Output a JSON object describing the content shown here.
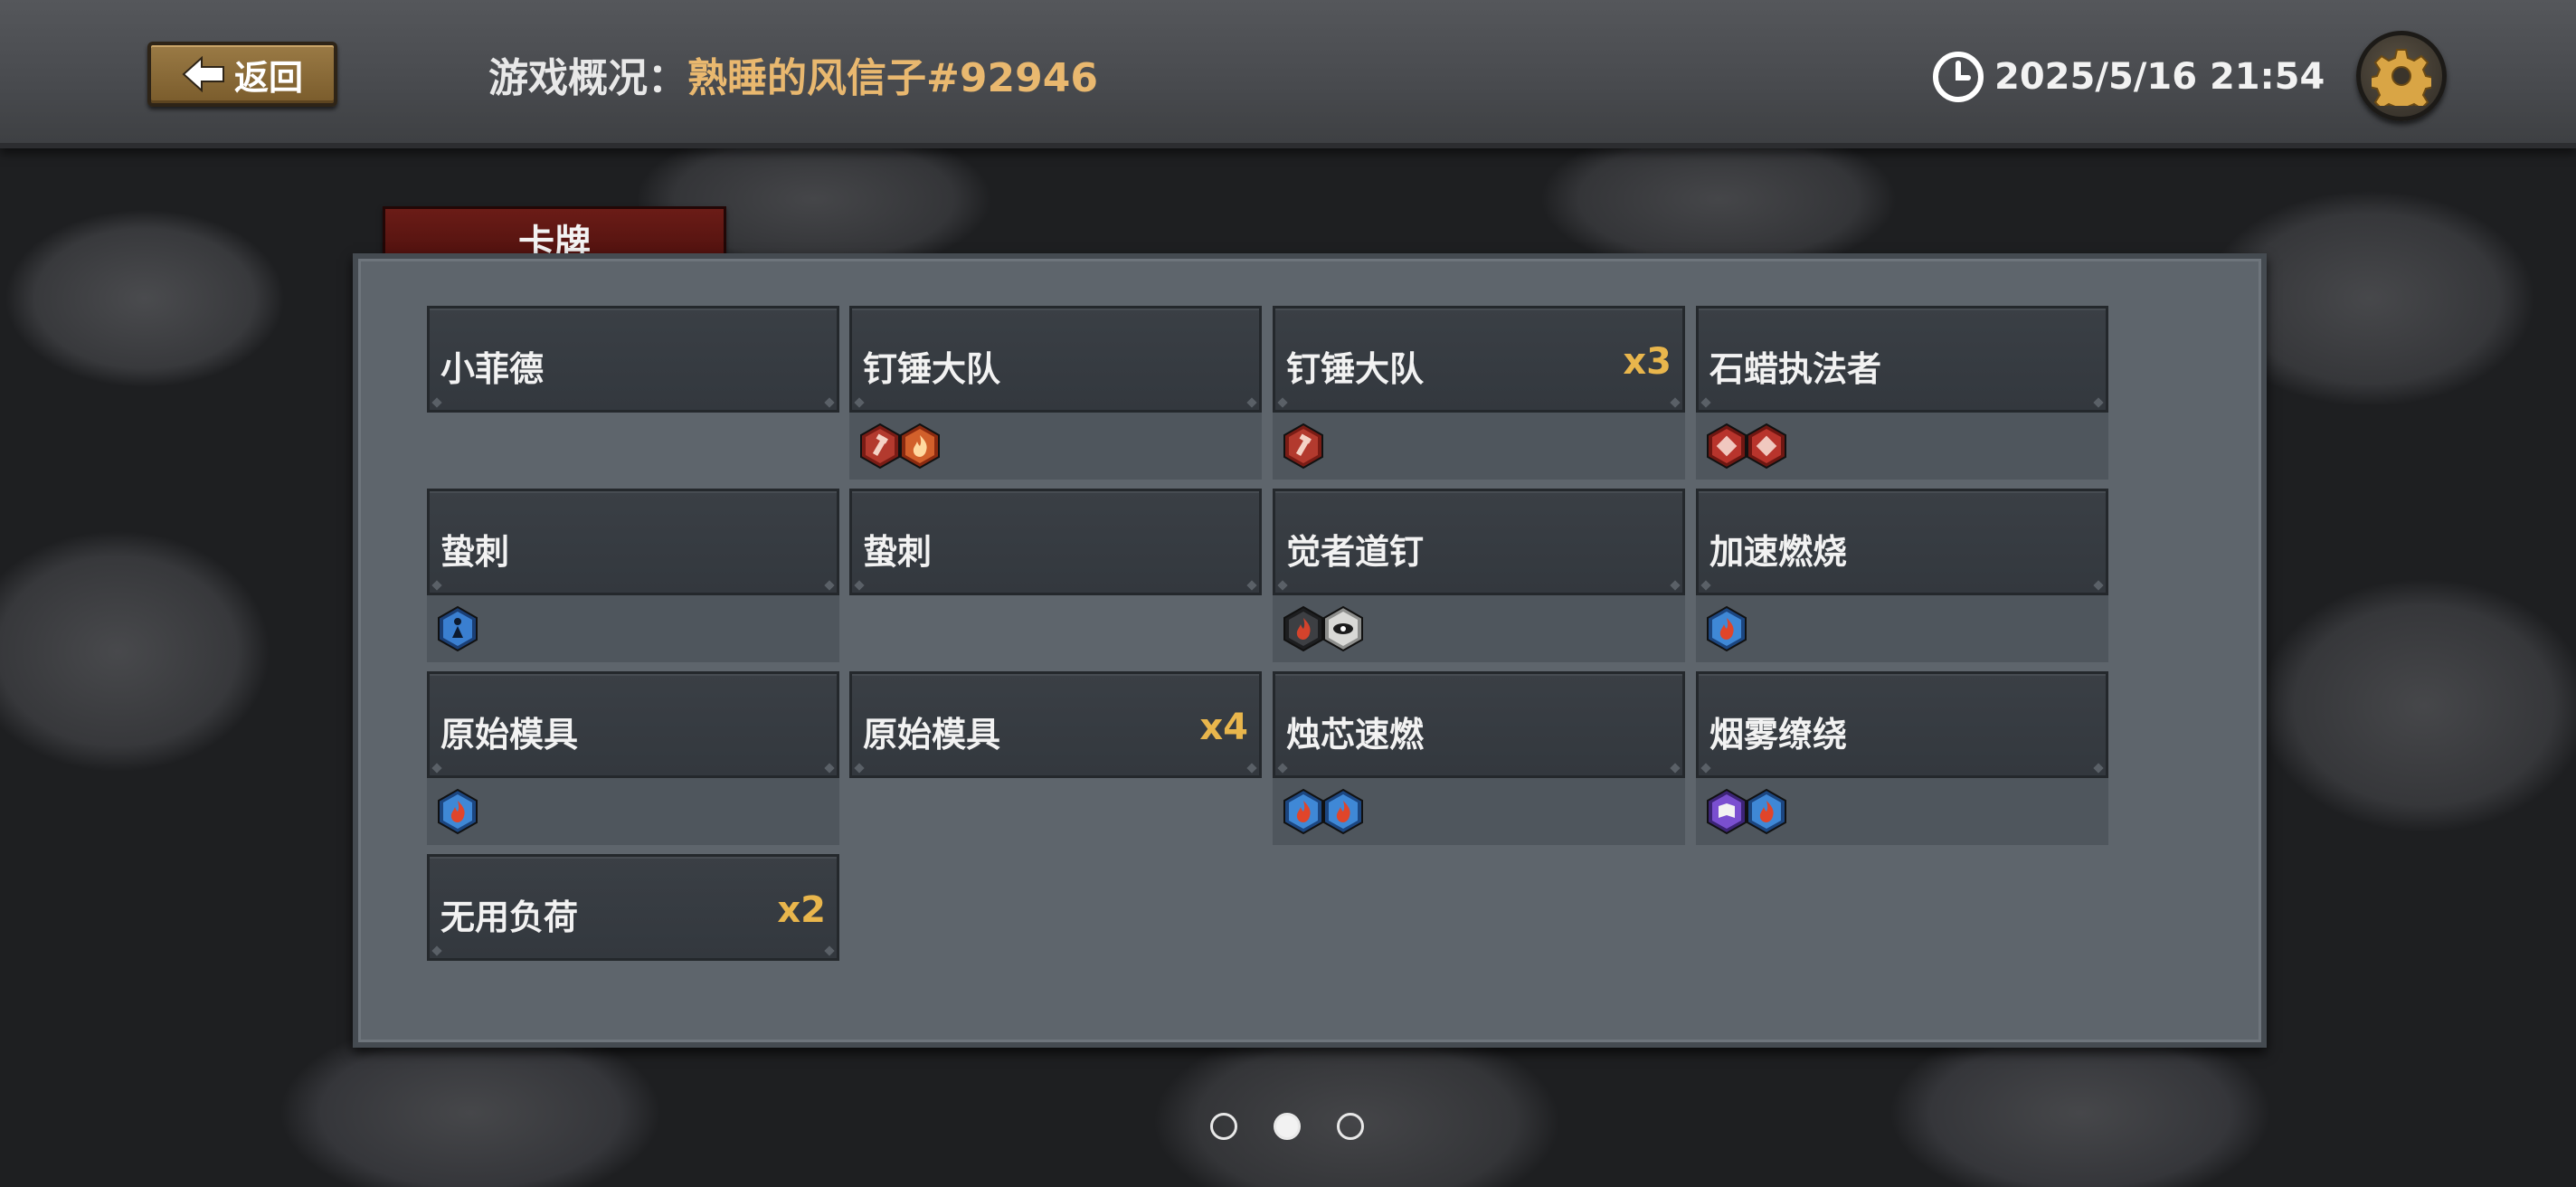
{
  "header": {
    "back_label": "返回",
    "title_label": "游戏概况：",
    "player_name": "熟睡的风信子#92946",
    "datetime": "2025/5/16 21:54"
  },
  "tab_label": "卡牌",
  "colors": {
    "accent_gold": "#e9b64c",
    "name_orange": "#e9b86f",
    "tab_red": "#5a1510"
  },
  "cards": [
    {
      "name": "小菲德",
      "count": "",
      "icons": []
    },
    {
      "name": "钉锤大队",
      "count": "",
      "icons": [
        "red-hammer-icon",
        "red-orange-fire-icon"
      ]
    },
    {
      "name": "钉锤大队",
      "count": "x3",
      "icons": [
        "red-hammer-icon"
      ]
    },
    {
      "name": "石蜡执法者",
      "count": "",
      "icons": [
        "red-scroll-icon",
        "red-scroll-icon"
      ]
    },
    {
      "name": "蛰刺",
      "count": "",
      "icons": [
        "blue-figure-icon"
      ]
    },
    {
      "name": "蛰刺",
      "count": "",
      "icons": []
    },
    {
      "name": "觉者道钉",
      "count": "",
      "icons": [
        "dark-fire-icon",
        "white-eye-icon"
      ]
    },
    {
      "name": "加速燃烧",
      "count": "",
      "icons": [
        "blue-fire-icon"
      ]
    },
    {
      "name": "原始模具",
      "count": "",
      "icons": [
        "blue-fire-icon"
      ]
    },
    {
      "name": "原始模具",
      "count": "x4",
      "icons": []
    },
    {
      "name": "烛芯速燃",
      "count": "",
      "icons": [
        "blue-fire-icon",
        "blue-fire-icon"
      ]
    },
    {
      "name": "烟雾缭绕",
      "count": "",
      "icons": [
        "purple-book-icon",
        "blue-fire-icon"
      ]
    },
    {
      "name": "无用负荷",
      "count": "x2",
      "icons": []
    }
  ],
  "pager": {
    "total": 3,
    "current": 2
  }
}
